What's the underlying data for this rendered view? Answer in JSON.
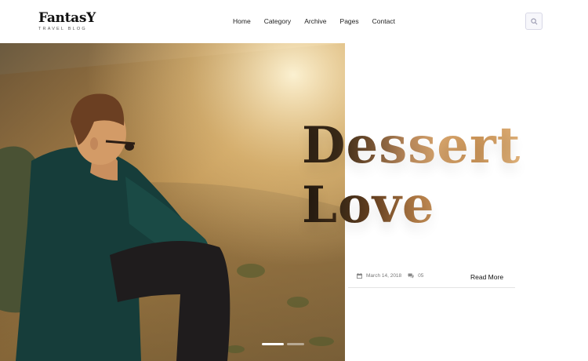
{
  "brand": {
    "name": "FantasY",
    "tagline": "TRAVEL BLOG"
  },
  "nav": {
    "items": [
      "Home",
      "Category",
      "Archive",
      "Pages",
      "Contact"
    ]
  },
  "search": {
    "icon": "search-icon"
  },
  "post": {
    "title_line1": "Dessert",
    "title_line2": "Love",
    "date": "March 14, 2018",
    "comments": "05",
    "read_more": "Read More"
  },
  "slider": {
    "slides": 2,
    "active": 1
  },
  "colors": {
    "title_gradient_dark": "#2b1f14",
    "title_gradient_light": "#d6a46c",
    "divider": "#e4e4e4"
  }
}
